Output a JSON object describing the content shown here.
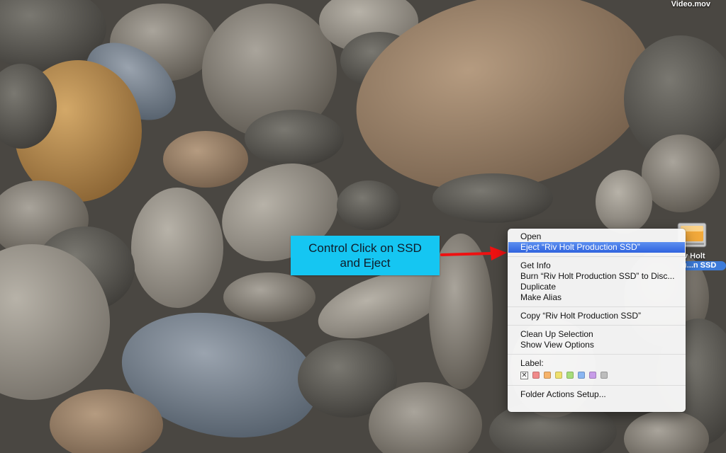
{
  "desktop": {
    "file_label": "Video.mov",
    "drive": {
      "label_line1": "v Holt",
      "label_line2": "u...n SSD"
    }
  },
  "callout": {
    "line1": "Control Click on SSD",
    "line2": "and Eject",
    "color": "#15c6f2"
  },
  "arrow": {
    "color": "#e11"
  },
  "context_menu": {
    "open": "Open",
    "eject": "Eject “Riv Holt Production SSD”",
    "get_info": "Get Info",
    "burn": "Burn “Riv Holt Production SSD” to Disc...",
    "duplicate": "Duplicate",
    "make_alias": "Make Alias",
    "copy": "Copy “Riv Holt Production SSD”",
    "clean_up": "Clean Up Selection",
    "show_view_options": "Show View Options",
    "label_heading": "Label:",
    "label_none": "✕",
    "label_colors": [
      "#f08a8a",
      "#f6b36b",
      "#efe06e",
      "#a7dd7a",
      "#8ab6f2",
      "#c79ce8",
      "#bdbdbd"
    ],
    "folder_actions": "Folder Actions Setup..."
  }
}
